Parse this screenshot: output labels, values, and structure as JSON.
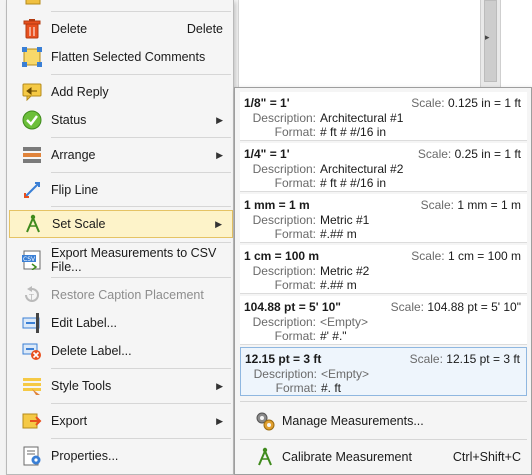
{
  "context_menu": {
    "delete": {
      "label": "Delete",
      "shortcut": "Delete"
    },
    "flatten": {
      "label": "Flatten Selected Comments"
    },
    "add_reply": {
      "label": "Add Reply"
    },
    "status": {
      "label": "Status"
    },
    "arrange": {
      "label": "Arrange"
    },
    "flip_line": {
      "label": "Flip Line"
    },
    "set_scale": {
      "label": "Set Scale"
    },
    "export_csv": {
      "label": "Export Measurements to CSV File..."
    },
    "restore_caption": {
      "label": "Restore Caption Placement"
    },
    "edit_label": {
      "label": "Edit Label..."
    },
    "delete_label": {
      "label": "Delete Label..."
    },
    "style_tools": {
      "label": "Style Tools"
    },
    "export": {
      "label": "Export"
    },
    "properties": {
      "label": "Properties..."
    }
  },
  "scale_submenu": {
    "labels": {
      "scale": "Scale:",
      "description": "Description:",
      "format": "Format:"
    },
    "scales": [
      {
        "name": "1/8\" = 1'",
        "scale": "0.125 in = 1 ft",
        "description": "Architectural #1",
        "format": "# ft # #/16 in"
      },
      {
        "name": "1/4\" = 1'",
        "scale": "0.25 in = 1 ft",
        "description": "Architectural #2",
        "format": "# ft # #/16 in"
      },
      {
        "name": "1 mm = 1 m",
        "scale": "1 mm = 1 m",
        "description": "Metric #1",
        "format": "#.## m"
      },
      {
        "name": "1 cm = 100 m",
        "scale": "1 cm = 100 m",
        "description": "Metric #2",
        "format": "#.## m"
      },
      {
        "name": "104.88 pt = 5' 10\"",
        "scale": "104.88 pt = 5' 10\"",
        "description": "<Empty>",
        "format": "#' #.\""
      },
      {
        "name": "12.15 pt = 3 ft",
        "scale": "12.15 pt = 3 ft",
        "description": "<Empty>",
        "format": "#. ft"
      }
    ],
    "manage": {
      "label": "Manage Measurements..."
    },
    "calibrate": {
      "label": "Calibrate Measurement",
      "shortcut": "Ctrl+Shift+C"
    }
  }
}
